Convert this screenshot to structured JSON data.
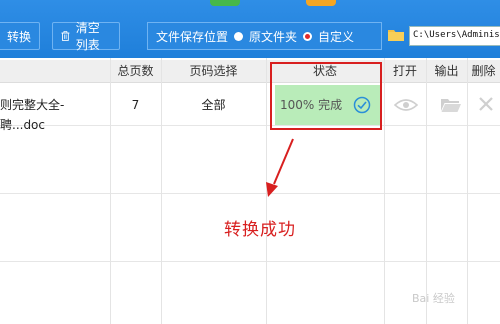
{
  "toolbar": {
    "convert_label": "转换",
    "clear_list_label": "清空列表",
    "save_location_label": "文件保存位置",
    "option_original": "原文件夹",
    "option_custom": "自定义",
    "path_value": "C:\\Users\\Adminis"
  },
  "table": {
    "headers": [
      "总页数",
      "页码选择",
      "状态",
      "打开",
      "输出",
      "删除"
    ],
    "row": {
      "file_name": "则完整大全-聘...doc",
      "pages": "7",
      "page_selection": "全部",
      "status": "100% 完成"
    }
  },
  "annotation": "转换成功",
  "watermark": "Bai 经验",
  "icons": [
    "trash-icon",
    "radio-icon",
    "folder-icon",
    "check-circle-icon",
    "eye-icon",
    "open-folder-icon",
    "delete-icon",
    "arrow-icon"
  ],
  "colors": {
    "toolbar": "#1f7fda",
    "highlight_border": "#d81f1f",
    "status_fill": "#b9ecb9",
    "check": "#2a8fd8"
  }
}
